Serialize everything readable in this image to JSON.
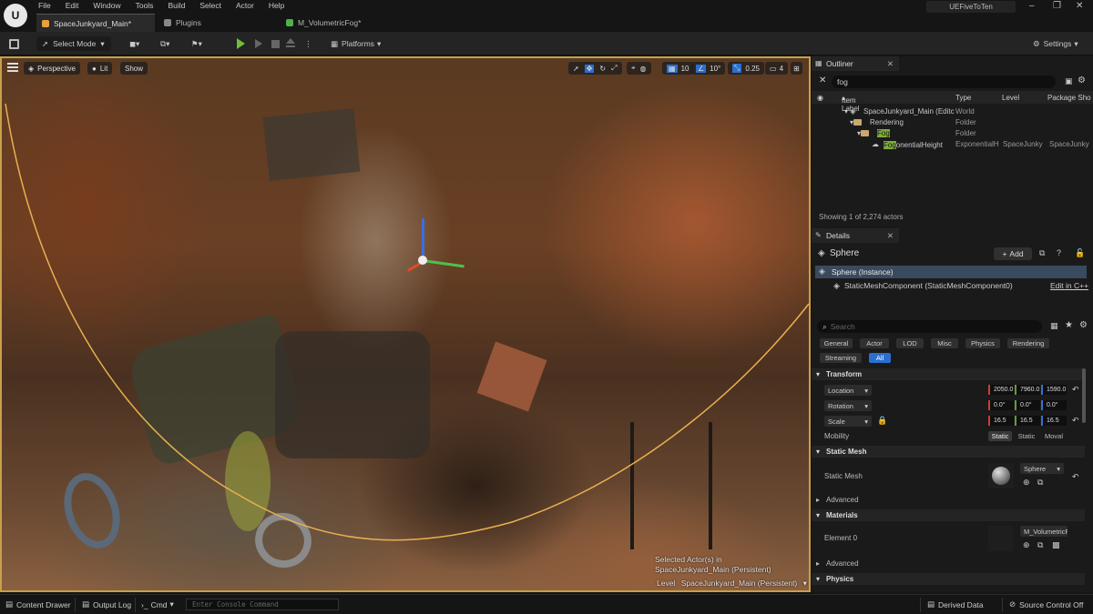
{
  "menu": {
    "logo": "U",
    "items": [
      "File",
      "Edit",
      "Window",
      "Tools",
      "Build",
      "Select",
      "Actor",
      "Help"
    ],
    "project": "UEFiveToTen"
  },
  "tabs": {
    "level": "SpaceJunkyard_Main*",
    "plugins": "Plugins",
    "material": "M_VolumetricFog*"
  },
  "toolbar": {
    "select_mode": "Select Mode",
    "platforms": "Platforms",
    "settings": "Settings"
  },
  "viewport": {
    "perspective": "Perspective",
    "lit": "Lit",
    "show": "Show",
    "grid_snap": "10",
    "rot_snap": "10°",
    "scale_snap": "0.25",
    "camera_speed": "4",
    "selected_line1": "Selected Actor(s) in",
    "selected_line2": "SpaceJunkyard_Main (Persistent)",
    "level_label": "Level",
    "level_value": "SpaceJunkyard_Main (Persistent)"
  },
  "outliner": {
    "tab": "Outliner",
    "search": "fog",
    "col_label": "Item Label",
    "col_type": "Type",
    "col_level": "Level",
    "col_package": "Package Sho",
    "rows": [
      {
        "label": "SpaceJunkyard_Main (Editc",
        "type": "World",
        "level": "",
        "pkg": ""
      },
      {
        "label": "Rendering",
        "type": "Folder",
        "level": "",
        "pkg": ""
      },
      {
        "label": "Fog",
        "type": "Folder",
        "level": "",
        "pkg": ""
      },
      {
        "label_pre": "ExponentialHeight",
        "label_hl": "Fog",
        "type": "ExponentialH",
        "level": "SpaceJunky",
        "pkg": "SpaceJunky"
      }
    ],
    "showing": "Showing 1 of 2,274 actors"
  },
  "details": {
    "tab": "Details",
    "actor": "Sphere",
    "add": "Add",
    "instance": "Sphere (Instance)",
    "component": "StaticMeshComponent (StaticMeshComponent0)",
    "edit_cpp": "Edit in C++",
    "search_placeholder": "Search",
    "filters": [
      "General",
      "Actor",
      "LOD",
      "Misc",
      "Physics",
      "Rendering",
      "Streaming",
      "All"
    ],
    "sections": {
      "transform": "Transform",
      "static_mesh": "Static Mesh",
      "advanced": "Advanced",
      "materials": "Materials",
      "advanced2": "Advanced",
      "physics": "Physics"
    },
    "location": {
      "label": "Location",
      "x": "2050.0",
      "y": "7960.0",
      "z": "1590.0"
    },
    "rotation": {
      "label": "Rotation",
      "x": "0.0°",
      "y": "0.0°",
      "z": "0.0°"
    },
    "scale": {
      "label": "Scale",
      "x": "16.5",
      "y": "16.5",
      "z": "16.5"
    },
    "mobility": {
      "label": "Mobility",
      "options": [
        "Static",
        "Static",
        "Moval"
      ]
    },
    "static_mesh_label": "Static Mesh",
    "static_mesh_value": "Sphere",
    "element0_label": "Element 0",
    "element0_value": "M_VolumetricF"
  },
  "bottom": {
    "content_drawer": "Content Drawer",
    "output_log": "Output Log",
    "cmd": "Cmd",
    "console_placeholder": "Enter Console Command",
    "derived_data": "Derived Data",
    "source_control": "Source Control Off"
  }
}
